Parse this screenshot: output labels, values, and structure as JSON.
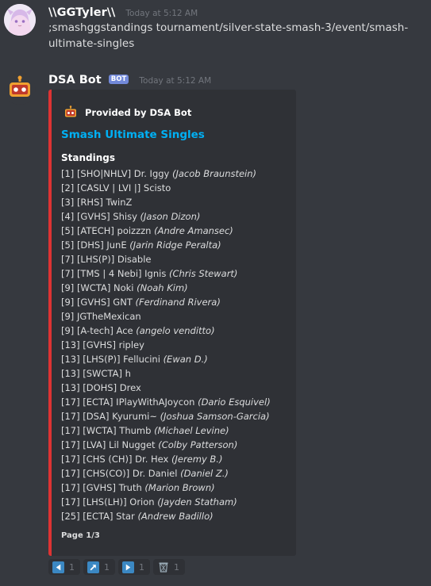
{
  "messages": [
    {
      "username": "\\\\GGTyler\\\\",
      "timestamp": "Today at 5:12 AM",
      "content": ";smashggstandings tournament/silver-state-smash-3/event/smash-ultimate-singles"
    },
    {
      "username": "DSA Bot",
      "bot_tag": "BOT",
      "timestamp": "Today at 5:12 AM"
    }
  ],
  "embed": {
    "accent_color": "#dd3333",
    "author": "Provided by DSA Bot",
    "title": "Smash Ultimate Singles",
    "field_name": "Standings",
    "footer": "Page 1/3",
    "standings": [
      {
        "text": "[1] [SHO|NHLV] Dr. Iggy",
        "real": "(Jacob Braunstein)"
      },
      {
        "text": "[2] [CASLV | LVI |] Scisto",
        "real": ""
      },
      {
        "text": "[3] [RHS] TwinZ",
        "real": ""
      },
      {
        "text": "[4] [GVHS] Shisy",
        "real": "(Jason Dizon)"
      },
      {
        "text": "[5] [ATECH] poizzzn",
        "real": "(Andre Amansec)"
      },
      {
        "text": "[5] [DHS] JunE",
        "real": "(Jarin Ridge Peralta)"
      },
      {
        "text": "[7] [LHS(P)] Disable",
        "real": ""
      },
      {
        "text": "[7] [TMS | 4 Nebi] Ignis",
        "real": "(Chris Stewart)"
      },
      {
        "text": "[9] [WCTA] Noki",
        "real": "(Noah Kim)"
      },
      {
        "text": "[9] [GVHS] GNT",
        "real": "(Ferdinand Rivera)"
      },
      {
        "text": "[9] JGTheMexican",
        "real": ""
      },
      {
        "text": "[9] [A-tech] Ace",
        "real": "(angelo venditto)"
      },
      {
        "text": "[13] [GVHS] ripley",
        "real": ""
      },
      {
        "text": "[13] [LHS(P)] Fellucini",
        "real": "(Ewan D.)"
      },
      {
        "text": "[13] [SWCTA] h",
        "real": ""
      },
      {
        "text": "[13] [DOHS] Drex",
        "real": ""
      },
      {
        "text": "[17] [ECTA] IPlayWithAJoycon",
        "real": "(Dario Esquivel)"
      },
      {
        "text": "[17] [DSA] Kyurumi~",
        "real": "(Joshua Samson-Garcia)"
      },
      {
        "text": "[17] [WCTA] Thumb",
        "real": "(Michael Levine)"
      },
      {
        "text": "[17] [LVA] Lil Nugget",
        "real": "(Colby Patterson)"
      },
      {
        "text": "[17] [CHS (CH)] Dr. Hex",
        "real": "(Jeremy B.)"
      },
      {
        "text": "[17] [CHS(CO)] Dr. Daniel",
        "real": "(Daniel Z.)"
      },
      {
        "text": "[17] [GVHS] Truth",
        "real": "(Marion Brown)"
      },
      {
        "text": "[17] [LHS(LH)] Orion",
        "real": "(Jayden Statham)"
      },
      {
        "text": "[25] [ECTA] Star",
        "real": "(Andrew Badillo)"
      }
    ]
  },
  "reactions": [
    {
      "icon": "arrow-backward-icon",
      "count": "1"
    },
    {
      "icon": "arrow-upper-right-icon",
      "count": "1"
    },
    {
      "icon": "arrow-forward-icon",
      "count": "1"
    },
    {
      "icon": "wastebasket-icon",
      "count": "1"
    }
  ]
}
